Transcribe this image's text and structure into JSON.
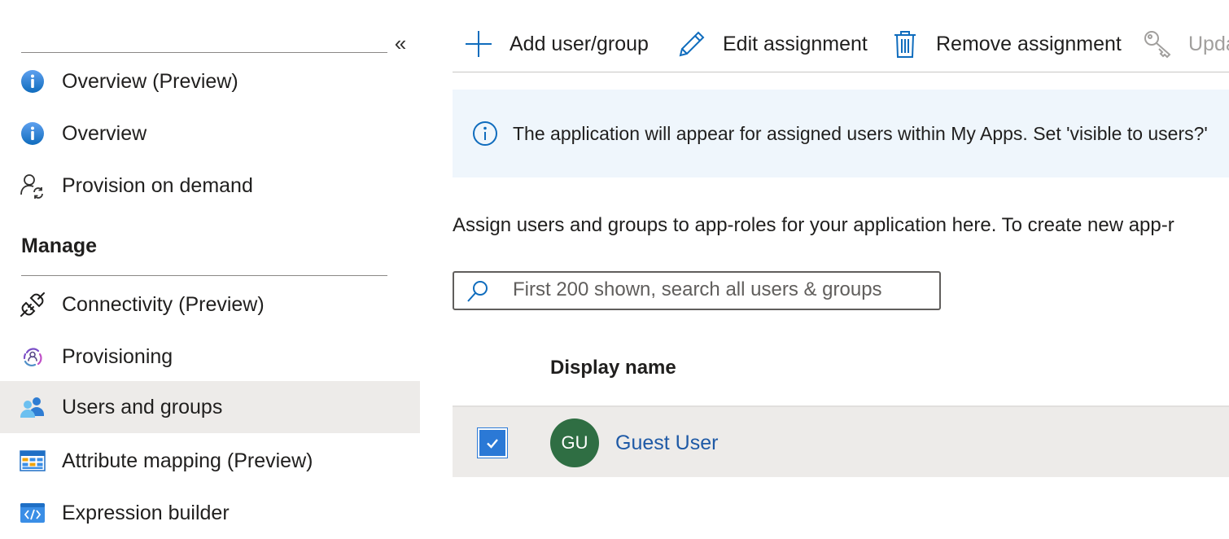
{
  "sidebar": {
    "collapse_glyph": "«",
    "top_items": [
      {
        "label": "Overview (Preview)",
        "icon": "info-icon"
      },
      {
        "label": "Overview",
        "icon": "info-icon"
      },
      {
        "label": "Provision on demand",
        "icon": "user-sync-icon"
      }
    ],
    "section_heading": "Manage",
    "manage_items": [
      {
        "label": "Connectivity (Preview)",
        "icon": "plug-icon"
      },
      {
        "label": "Provisioning",
        "icon": "provisioning-icon"
      },
      {
        "label": "Users and groups",
        "icon": "users-icon",
        "selected": true
      },
      {
        "label": "Attribute mapping (Preview)",
        "icon": "table-icon"
      },
      {
        "label": "Expression builder",
        "icon": "code-icon"
      }
    ]
  },
  "toolbar": {
    "add_label": "Add user/group",
    "edit_label": "Edit assignment",
    "remove_label": "Remove assignment",
    "update_label": "Upda"
  },
  "banner": {
    "text": "The application will appear for assigned users within My Apps. Set 'visible to users?'"
  },
  "description": "Assign users and groups to app-roles for your application here. To create new app-r",
  "search": {
    "placeholder": "First 200 shown, search all users & groups",
    "value": ""
  },
  "table": {
    "columns": [
      "Display name"
    ],
    "rows": [
      {
        "initials": "GU",
        "display_name": "Guest User",
        "checked": true
      }
    ]
  },
  "colors": {
    "accent": "#2b79d6",
    "selected_bg": "#edebe9",
    "banner_bg": "#eff6fc",
    "avatar_bg": "#2f6e43",
    "link": "#1f5aa6"
  }
}
